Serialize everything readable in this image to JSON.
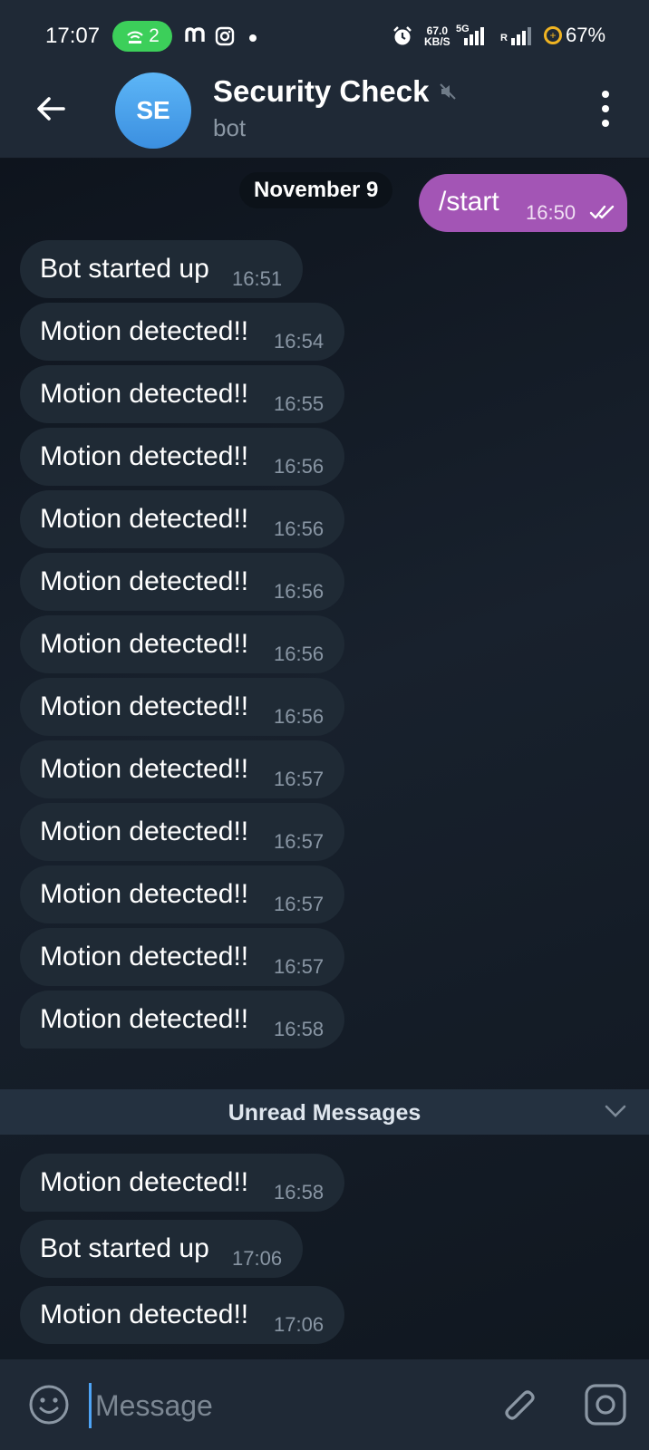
{
  "status_bar": {
    "time": "17:07",
    "hotspot_count": "2",
    "net_speed_value": "67.0",
    "net_speed_unit": "KB/S",
    "network_type": "5G",
    "roaming": "R",
    "battery": "67%"
  },
  "header": {
    "avatar_initials": "SE",
    "title": "Security Check",
    "subtitle": "bot"
  },
  "chat": {
    "date_label": "November 9",
    "outgoing": {
      "text": "/start",
      "time": "16:50"
    },
    "messages_before_unread": [
      {
        "text": "Bot started up",
        "time": "16:51"
      },
      {
        "text": "Motion detected!!",
        "time": "16:54"
      },
      {
        "text": "Motion detected!!",
        "time": "16:55"
      },
      {
        "text": "Motion detected!!",
        "time": "16:56"
      },
      {
        "text": "Motion detected!!",
        "time": "16:56"
      },
      {
        "text": "Motion detected!!",
        "time": "16:56"
      },
      {
        "text": "Motion detected!!",
        "time": "16:56"
      },
      {
        "text": "Motion detected!!",
        "time": "16:56"
      },
      {
        "text": "Motion detected!!",
        "time": "16:57"
      },
      {
        "text": "Motion detected!!",
        "time": "16:57"
      },
      {
        "text": "Motion detected!!",
        "time": "16:57"
      },
      {
        "text": "Motion detected!!",
        "time": "16:57"
      },
      {
        "text": "Motion detected!!",
        "time": "16:58"
      }
    ],
    "unread_label": "Unread Messages",
    "messages_after_unread": [
      {
        "text": "Motion detected!!",
        "time": "16:58"
      },
      {
        "text": "Bot started up",
        "time": "17:06"
      },
      {
        "text": "Motion detected!!",
        "time": "17:06"
      }
    ]
  },
  "input": {
    "placeholder": "Message"
  },
  "colors": {
    "outgoing_bubble": "#a355b5",
    "incoming_bubble": "#1f2a35",
    "header_bg": "#1f2936",
    "accent": "#4ea4f6"
  }
}
